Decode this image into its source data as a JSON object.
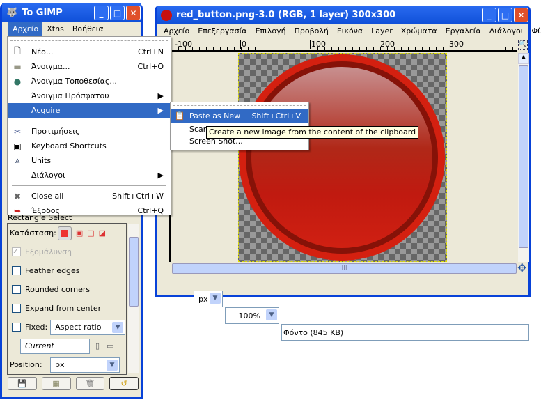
{
  "toolbox": {
    "title": "To GIMP",
    "menu": [
      "Αρχείο",
      "Xtns",
      "Βοήθεια"
    ],
    "tool_name": "Rectangle Select",
    "mode_label": "Κατάσταση:",
    "antialias": "Εξομάλυνση",
    "options": [
      "Feather edges",
      "Rounded corners",
      "Expand from center"
    ],
    "fixed_label": "Fixed:",
    "fixed_value": "Aspect ratio",
    "current_value": "Current",
    "position_label": "Position:",
    "position_unit": "px"
  },
  "file_menu": {
    "items": [
      {
        "label": "Νέο...",
        "shortcut": "Ctrl+N",
        "icon": "new-file-icon"
      },
      {
        "label": "Άνοιγμα...",
        "shortcut": "Ctrl+O",
        "icon": "folder-icon"
      },
      {
        "label": "Άνοιγμα Τοποθεσίας...",
        "shortcut": "",
        "icon": "globe-icon"
      },
      {
        "label": "Άνοιγμα Πρόσφατου",
        "shortcut": "",
        "submenu": true
      },
      {
        "label": "Acquire",
        "shortcut": "",
        "submenu": true,
        "highlighted": true
      },
      {
        "label": "Προτιμήσεις",
        "shortcut": "",
        "icon": "preferences-icon"
      },
      {
        "label": "Keyboard Shortcuts",
        "shortcut": "",
        "icon": "keyboard-icon"
      },
      {
        "label": "Units",
        "shortcut": "",
        "icon": "compass-icon"
      },
      {
        "label": "Διάλογοι",
        "shortcut": "",
        "submenu": true
      },
      {
        "label": "Close all",
        "shortcut": "Shift+Ctrl+W",
        "icon": "close-all-icon"
      },
      {
        "label": "Έξοδος",
        "shortcut": "Ctrl+Q",
        "icon": "exit-icon"
      }
    ]
  },
  "acquire_menu": {
    "items": [
      {
        "label": "Paste as New",
        "shortcut": "Shift+Ctrl+V"
      },
      {
        "label": "Scanner/Camera...",
        "shortcut": ""
      },
      {
        "label": "Screen Shot...",
        "shortcut": ""
      }
    ]
  },
  "tooltip": "Create a new image from the content of the clipboard",
  "image_window": {
    "title": "red_button.png-3.0 (RGB, 1 layer) 300x300",
    "menu": [
      "Αρχείο",
      "Επεξεργασία",
      "Επιλογή",
      "Προβολή",
      "Εικόνα",
      "Layer",
      "Χρώματα",
      "Εργαλεία",
      "Διάλογοι",
      "Φίλτρα"
    ],
    "ruler_labels": [
      "-100",
      "0",
      "100",
      "200",
      "300"
    ],
    "unit": "px",
    "zoom": "100%",
    "status": "Φόντο (845 KB)"
  },
  "colors": {
    "titlebar": "#0842d8",
    "highlight": "#316ac5",
    "button_red": "#d42010"
  }
}
